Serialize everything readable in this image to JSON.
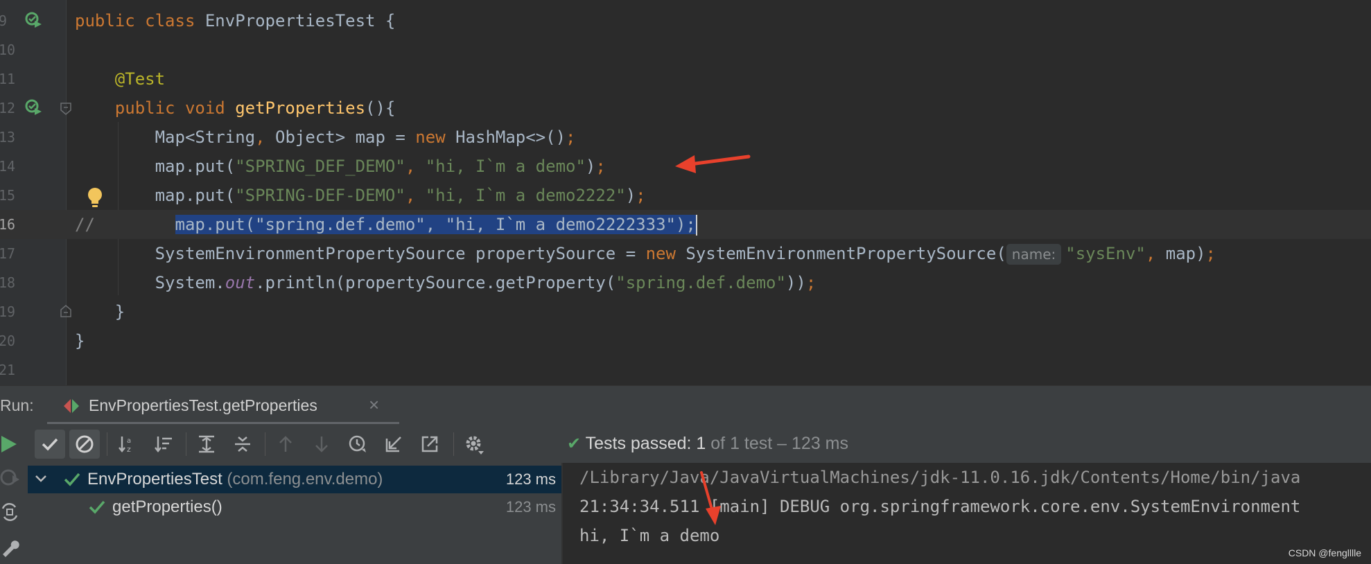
{
  "editor": {
    "lines": [
      {
        "num": "9",
        "tokens": [
          [
            "kw",
            "public class "
          ],
          [
            "plain",
            "EnvPropertiesTest {"
          ]
        ]
      },
      {
        "num": "10",
        "tokens": []
      },
      {
        "num": "11",
        "tokens": [
          [
            "plain",
            "    "
          ],
          [
            "ann",
            "@Test"
          ]
        ]
      },
      {
        "num": "12",
        "tokens": [
          [
            "plain",
            "    "
          ],
          [
            "kw",
            "public void "
          ],
          [
            "fn",
            "getProperties"
          ],
          [
            "plain",
            "(){"
          ]
        ]
      },
      {
        "num": "13",
        "tokens": [
          [
            "plain",
            "        Map<String"
          ],
          [
            "kw",
            ", "
          ],
          [
            "plain",
            "Object> map = "
          ],
          [
            "kw",
            "new "
          ],
          [
            "plain",
            "HashMap<>()"
          ],
          [
            "kw",
            ";"
          ]
        ]
      },
      {
        "num": "14",
        "tokens": [
          [
            "plain",
            "        map.put("
          ],
          [
            "str",
            "\"SPRING_DEF_DEMO\""
          ],
          [
            "kw",
            ", "
          ],
          [
            "str",
            "\"hi, I`m a demo\""
          ],
          [
            "plain",
            ")"
          ],
          [
            "kw",
            ";"
          ]
        ]
      },
      {
        "num": "15",
        "tokens": [
          [
            "plain",
            "        map.put("
          ],
          [
            "str",
            "\"SPRING-DEF-DEMO\""
          ],
          [
            "kw",
            ", "
          ],
          [
            "str",
            "\"hi, I`m a demo2222\""
          ],
          [
            "plain",
            ")"
          ],
          [
            "kw",
            ";"
          ]
        ]
      },
      {
        "num": "16",
        "tokens": [
          [
            "cmt",
            "//        "
          ],
          [
            "sel",
            "map.put(\"spring.def.demo\", \"hi, I`m a demo2222333\");"
          ]
        ]
      },
      {
        "num": "17",
        "tokens": [
          [
            "plain",
            "        SystemEnvironmentPropertySource propertySource = "
          ],
          [
            "kw",
            "new "
          ],
          [
            "plain",
            "SystemEnvironmentPropertySource("
          ],
          [
            "hint",
            "name:"
          ],
          [
            "str",
            "\"sysEnv\""
          ],
          [
            "kw",
            ", "
          ],
          [
            "plain",
            "map)"
          ],
          [
            "kw",
            ";"
          ]
        ]
      },
      {
        "num": "18",
        "tokens": [
          [
            "plain",
            "        System."
          ],
          [
            "fld",
            "out"
          ],
          [
            "plain",
            ".println(propertySource.getProperty("
          ],
          [
            "str",
            "\"spring.def.demo\""
          ],
          [
            "plain",
            "))"
          ],
          [
            "kw",
            ";"
          ]
        ]
      },
      {
        "num": "19",
        "tokens": [
          [
            "plain",
            "    }"
          ]
        ]
      },
      {
        "num": "20",
        "tokens": [
          [
            "plain",
            "}"
          ]
        ]
      },
      {
        "num": "21",
        "tokens": []
      }
    ],
    "current_line": "16"
  },
  "run": {
    "label": "Run:",
    "tab_label": "EnvPropertiesTest.getProperties",
    "tab_close": "×"
  },
  "status": {
    "check": "✔",
    "strong": "Tests passed: 1",
    "dim": " of 1 test – 123 ms"
  },
  "tree": {
    "root_label": "EnvPropertiesTest",
    "root_pkg": " (com.feng.env.demo)",
    "root_time": "123 ms",
    "child_label": "getProperties()",
    "child_time": "123 ms"
  },
  "console": {
    "lines": [
      "/Library/Java/JavaVirtualMachines/jdk-11.0.16.jdk/Contents/Home/bin/java",
      "21:34:34.511 [main] DEBUG org.springframework.core.env.SystemEnvironment",
      "hi, I`m a demo"
    ]
  },
  "watermark": "CSDN @fenglllle",
  "colors": {
    "editor_bg": "#2b2b2b",
    "keyword": "#cc7832",
    "string": "#6a8759",
    "annotation": "#bbb529",
    "method": "#ffc66d",
    "selection": "#214283",
    "passed_green": "#59a869",
    "arrow_red": "#e8412c"
  }
}
